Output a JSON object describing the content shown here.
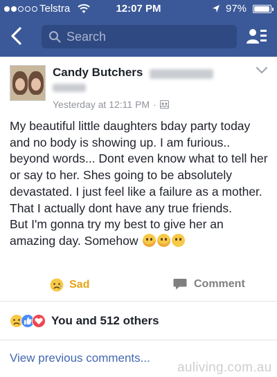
{
  "status_bar": {
    "carrier": "Telstra",
    "time": "12:07 PM",
    "battery_percent": "97%",
    "battery_level": 0.97,
    "signal_bars_filled": 2,
    "signal_bars_total": 5
  },
  "nav": {
    "search_placeholder": "Search",
    "back_icon": "chevron-left-icon",
    "friends_icon": "friends-list-icon"
  },
  "post": {
    "author": "Candy Butchers",
    "timestamp": "Yesterday at 12:11 PM",
    "separator": "·",
    "privacy_icon": "friends-audience-icon",
    "paragraphs": [
      "My beautiful little daughters bday party today and no body is showing up. I am furious.. beyond words... Dont even know what to tell her or say to her. Shes going to be absolutely devastated. I just feel like a failure as a mother. That I actually dont have any true friends.",
      "But I'm gonna try my best to give her an amazing day. Somehow"
    ],
    "trailing_emoji": [
      "crying-face-emoji",
      "crying-face-emoji",
      "sad-face-emoji"
    ]
  },
  "actions": {
    "reaction_label": "Sad",
    "comment_label": "Comment"
  },
  "reactions": {
    "types": [
      "sad",
      "like",
      "love"
    ],
    "summary": "You and 512 others"
  },
  "comments": {
    "view_previous": "View previous comments..."
  },
  "watermark": "auliving.com.au",
  "colors": {
    "brand_blue": "#3b5998",
    "search_bg": "#2f4a82",
    "sad_yellow": "#e8a317",
    "link_blue": "#4267b2",
    "like_blue": "#4a8df8",
    "love_red": "#f0454e"
  }
}
